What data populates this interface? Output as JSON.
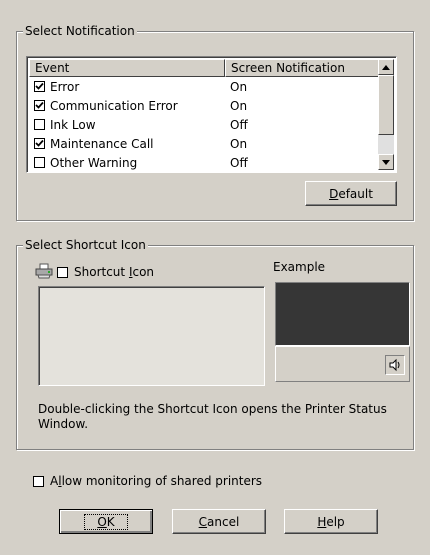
{
  "notification_group": {
    "title": "Select Notification",
    "columns": [
      "Event",
      "Screen Notification"
    ],
    "rows": [
      {
        "event": "Error",
        "checked": true,
        "notification": "On"
      },
      {
        "event": "Communication Error",
        "checked": true,
        "notification": "On"
      },
      {
        "event": "Ink Low",
        "checked": false,
        "notification": "Off"
      },
      {
        "event": "Maintenance Call",
        "checked": true,
        "notification": "On"
      },
      {
        "event": "Other Warning",
        "checked": false,
        "notification": "Off"
      }
    ],
    "default_button": {
      "pre": "",
      "key": "D",
      "post": "efault"
    }
  },
  "shortcut_group": {
    "title": "Select Shortcut Icon",
    "checkbox": {
      "pre": "Shortcut ",
      "key": "I",
      "post": "con",
      "checked": false
    },
    "example_label": "Example",
    "description": "Double-clicking the Shortcut Icon opens the Printer Status Window."
  },
  "shared_monitor": {
    "pre": "A",
    "key": "l",
    "post": "low monitoring of shared printers",
    "checked": false
  },
  "buttons": {
    "ok": {
      "pre": "",
      "key": "O",
      "post": "K"
    },
    "cancel": {
      "pre": "",
      "key": "C",
      "post": "ancel"
    },
    "help": {
      "pre": "",
      "key": "H",
      "post": "elp"
    }
  },
  "icons": {
    "printer": "printer-icon",
    "speaker": "speaker-icon",
    "scroll_up": "scroll-up-arrow-icon",
    "scroll_down": "scroll-down-arrow-icon"
  }
}
